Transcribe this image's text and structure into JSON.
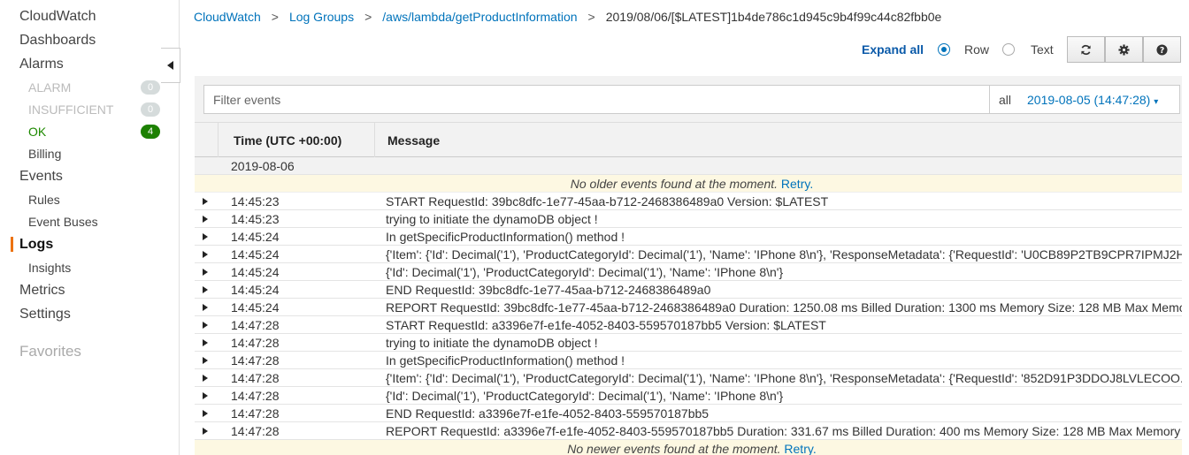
{
  "sidebar": {
    "cloudwatch": "CloudWatch",
    "dashboards": "Dashboards",
    "alarms": "Alarms",
    "alarm_states": [
      {
        "label": "ALARM",
        "count": "0"
      },
      {
        "label": "INSUFFICIENT",
        "count": "0"
      },
      {
        "label": "OK",
        "count": "4"
      }
    ],
    "billing": "Billing",
    "events": "Events",
    "rules": "Rules",
    "event_buses": "Event Buses",
    "logs": "Logs",
    "insights": "Insights",
    "metrics": "Metrics",
    "settings": "Settings",
    "favorites": "Favorites",
    "active_color": "#ec7211"
  },
  "breadcrumb": {
    "items": [
      "CloudWatch",
      "Log Groups",
      "/aws/lambda/getProductInformation"
    ],
    "current": "2019/08/06/[$LATEST]1b4de786c1d945c9b4f99c44c82fbb0e"
  },
  "toolbar": {
    "expand_all": "Expand all",
    "view_options": [
      {
        "label": "Row",
        "selected": true
      },
      {
        "label": "Text",
        "selected": false
      }
    ],
    "buttons": [
      "refresh-icon",
      "gear-icon",
      "help-icon"
    ]
  },
  "filter": {
    "placeholder": "Filter events",
    "range_all": "all",
    "range_start": "2019-08-05 (14:47:28)"
  },
  "table": {
    "headers": {
      "time": "Time (UTC +00:00)",
      "message": "Message"
    },
    "date_group": "2019-08-06",
    "older_notice": "No older events found at the moment.",
    "newer_notice": "No newer events found at the moment.",
    "retry": "Retry.",
    "rows": [
      {
        "time": "14:45:23",
        "message": "START RequestId: 39bc8dfc-1e77-45aa-b712-2468386489a0 Version: $LATEST"
      },
      {
        "time": "14:45:23",
        "message": "trying to initiate the dynamoDB object !"
      },
      {
        "time": "14:45:24",
        "message": "In getSpecificProductInformation() method !"
      },
      {
        "time": "14:45:24",
        "message": "{'Item': {'Id': Decimal('1'), 'ProductCategoryId': Decimal('1'), 'Name': 'IPhone 8\\n'}, 'ResponseMetadata': {'RequestId': 'U0CB89P2TB9CPR7IPMJ2H"
      },
      {
        "time": "14:45:24",
        "message": "{'Id': Decimal('1'), 'ProductCategoryId': Decimal('1'), 'Name': 'IPhone 8\\n'}"
      },
      {
        "time": "14:45:24",
        "message": "END RequestId: 39bc8dfc-1e77-45aa-b712-2468386489a0"
      },
      {
        "time": "14:45:24",
        "message": "REPORT RequestId: 39bc8dfc-1e77-45aa-b712-2468386489a0 Duration: 1250.08 ms Billed Duration: 1300 ms Memory Size: 128 MB Max Memo"
      },
      {
        "time": "14:47:28",
        "message": "START RequestId: a3396e7f-e1fe-4052-8403-559570187bb5 Version: $LATEST"
      },
      {
        "time": "14:47:28",
        "message": "trying to initiate the dynamoDB object !"
      },
      {
        "time": "14:47:28",
        "message": "In getSpecificProductInformation() method !"
      },
      {
        "time": "14:47:28",
        "message": "{'Item': {'Id': Decimal('1'), 'ProductCategoryId': Decimal('1'), 'Name': 'IPhone 8\\n'}, 'ResponseMetadata': {'RequestId': '852D91P3DDOJ8LVLECOO."
      },
      {
        "time": "14:47:28",
        "message": "{'Id': Decimal('1'), 'ProductCategoryId': Decimal('1'), 'Name': 'IPhone 8\\n'}"
      },
      {
        "time": "14:47:28",
        "message": "END RequestId: a3396e7f-e1fe-4052-8403-559570187bb5"
      },
      {
        "time": "14:47:28",
        "message": "REPORT RequestId: a3396e7f-e1fe-4052-8403-559570187bb5 Duration: 331.67 ms Billed Duration: 400 ms Memory Size: 128 MB Max Memory"
      }
    ]
  }
}
